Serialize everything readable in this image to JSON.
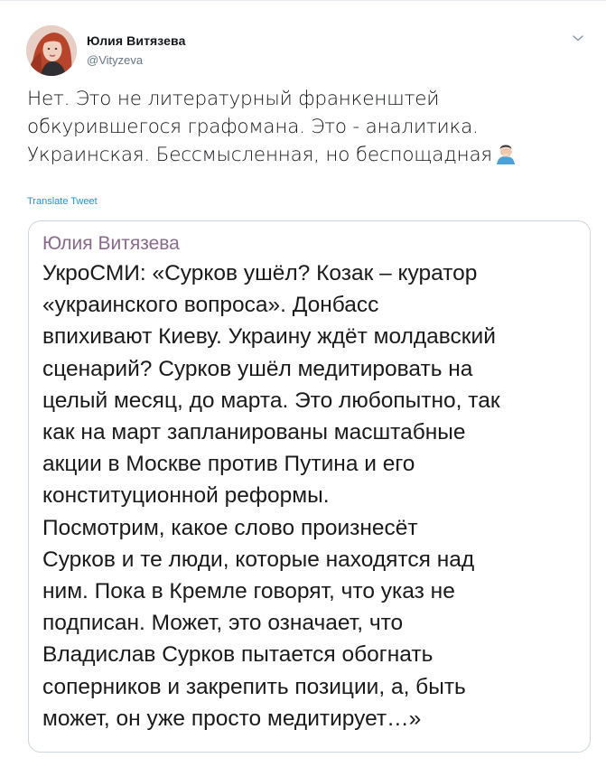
{
  "author": {
    "name": "Юлия Витязева",
    "handle": "@Vityzeva"
  },
  "tweet": {
    "text_lines": [
      "Нет. Это не литературный франкенштей",
      "обкурившегося графомана. Это - аналитика.",
      "Украинская. Бессмысленная, но беспощадная"
    ],
    "emoji": "facepalm-emoji",
    "translate_label": "Translate Tweet"
  },
  "media": {
    "quote_author": "Юлия Витязева",
    "quote_lines": [
      "УкроСМИ: «Сурков ушёл? Козак – куратор",
      "«украинского вопроса». Донбасс",
      "впихивают Киеву. Украину ждёт молдавский",
      "сценарий? Сурков ушёл медитировать на",
      "целый месяц, до марта. Это любопытно, так",
      "как на март запланированы масштабные",
      "акции в Москве против Путина и его",
      "конституционной реформы.",
      "Посмотрим, какое слово произнесёт",
      "Сурков и те люди, которые находятся над",
      "ним. Пока в Кремле говорят, что указ не",
      "подписан. Может, это означает, что",
      "Владислав Сурков пытается обогнать",
      "соперников и закрепить позиции, а, быть",
      "может, он уже просто медитирует…»"
    ]
  },
  "icons": {
    "caret": "chevron-down-icon",
    "avatar": "avatar"
  },
  "colors": {
    "link": "#1b95e0",
    "secondary_text": "#657786",
    "quote_author": "#8a6a8c",
    "border": "#ccd6dd"
  }
}
